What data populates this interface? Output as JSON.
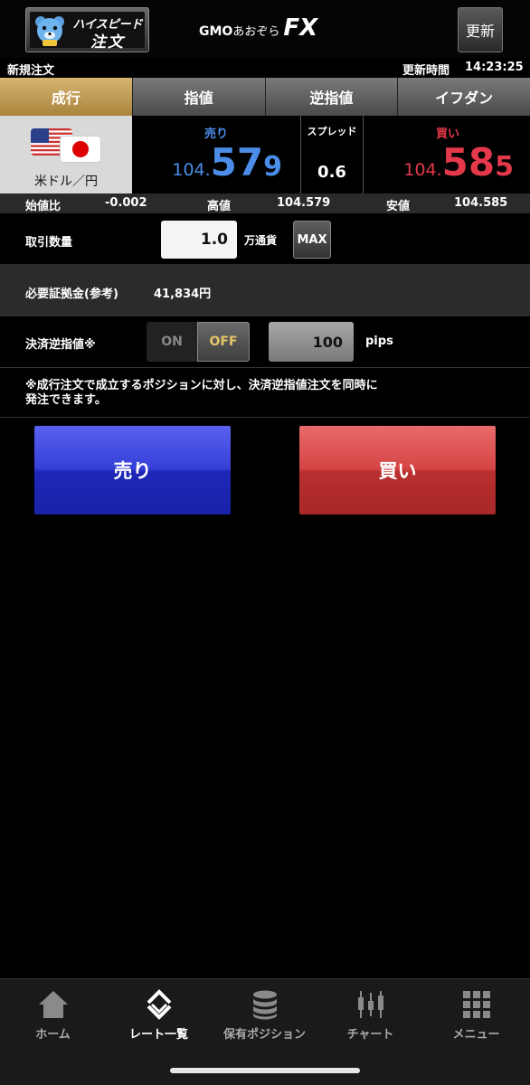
{
  "header": {
    "highspeed_line1": "ハイスピード",
    "highspeed_line2": "注文",
    "logo_gmo": "GMO",
    "logo_aozora": "あおぞら",
    "logo_fx": "FX",
    "refresh_label": "更新"
  },
  "info_bar": {
    "title": "新規注文",
    "update_label": "更新時間",
    "update_time": "14:23:25"
  },
  "tabs": [
    {
      "label": "成行",
      "active": true
    },
    {
      "label": "指値",
      "active": false
    },
    {
      "label": "逆指値",
      "active": false
    },
    {
      "label": "イフダン",
      "active": false
    }
  ],
  "quote": {
    "pair_name": "米ドル／円",
    "sell_label": "売り",
    "sell_price_prefix": "104.",
    "sell_price_big": "57",
    "sell_price_last": "9",
    "spread_label": "スプレッド",
    "spread_value": "0.6",
    "buy_label": "買い",
    "buy_price_prefix": "104.",
    "buy_price_big": "58",
    "buy_price_last": "5"
  },
  "ohlc": {
    "change_label": "始値比",
    "change_value": "-0.002",
    "high_label": "高値",
    "high_value": "104.579",
    "low_label": "安値",
    "low_value": "104.585"
  },
  "order": {
    "qty_label": "取引数量",
    "qty_value": "1.0",
    "qty_unit": "万通貨",
    "max_label": "MAX",
    "margin_label": "必要証拠金(参考)",
    "margin_value": "41,834円",
    "stop_label": "決済逆指値※",
    "toggle_on": "ON",
    "toggle_off": "OFF",
    "pips_value": "100",
    "pips_unit": "pips",
    "note_line1": "※成行注文で成立するポジションに対し、決済逆指値注文を同時に",
    "note_line2": "発注できます。"
  },
  "actions": {
    "sell_label": "売り",
    "buy_label": "買い"
  },
  "nav": [
    {
      "label": "ホーム",
      "icon": "home-icon",
      "active": false
    },
    {
      "label": "レート一覧",
      "icon": "rate-list-icon",
      "active": true
    },
    {
      "label": "保有ポジション",
      "icon": "coins-icon",
      "active": false
    },
    {
      "label": "チャート",
      "icon": "chart-icon",
      "active": false
    },
    {
      "label": "メニュー",
      "icon": "menu-grid-icon",
      "active": false
    }
  ],
  "colors": {
    "sell_blue": "#4b8de8",
    "buy_red": "#e3394a",
    "active_tab_gold": "#c9a65a",
    "toggle_off_text": "#e5c46a"
  }
}
